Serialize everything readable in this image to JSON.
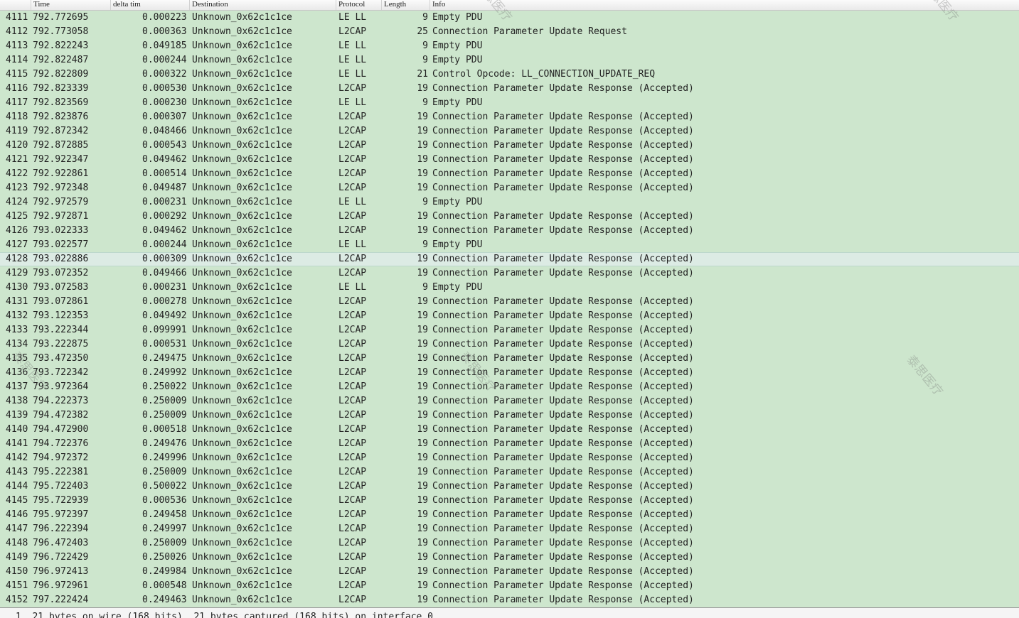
{
  "columns": {
    "time": "Time",
    "delta": "delta tim",
    "destination": "Destination",
    "protocol": "Protocol",
    "length": "Length",
    "info": "Info"
  },
  "rows": [
    {
      "no": "4111",
      "time": "792.772695",
      "delta": "0.000223",
      "destination": "Unknown_0x62c1c1ce",
      "protocol": "LE LL",
      "length": "9",
      "info": "Empty PDU"
    },
    {
      "no": "4112",
      "time": "792.773058",
      "delta": "0.000363",
      "destination": "Unknown_0x62c1c1ce",
      "protocol": "L2CAP",
      "length": "25",
      "info": "Connection Parameter Update Request"
    },
    {
      "no": "4113",
      "time": "792.822243",
      "delta": "0.049185",
      "destination": "Unknown_0x62c1c1ce",
      "protocol": "LE LL",
      "length": "9",
      "info": "Empty PDU"
    },
    {
      "no": "4114",
      "time": "792.822487",
      "delta": "0.000244",
      "destination": "Unknown_0x62c1c1ce",
      "protocol": "LE LL",
      "length": "9",
      "info": "Empty PDU"
    },
    {
      "no": "4115",
      "time": "792.822809",
      "delta": "0.000322",
      "destination": "Unknown_0x62c1c1ce",
      "protocol": "LE LL",
      "length": "21",
      "info": "Control Opcode: LL_CONNECTION_UPDATE_REQ"
    },
    {
      "no": "4116",
      "time": "792.823339",
      "delta": "0.000530",
      "destination": "Unknown_0x62c1c1ce",
      "protocol": "L2CAP",
      "length": "19",
      "info": "Connection Parameter Update Response (Accepted)"
    },
    {
      "no": "4117",
      "time": "792.823569",
      "delta": "0.000230",
      "destination": "Unknown_0x62c1c1ce",
      "protocol": "LE LL",
      "length": "9",
      "info": "Empty PDU"
    },
    {
      "no": "4118",
      "time": "792.823876",
      "delta": "0.000307",
      "destination": "Unknown_0x62c1c1ce",
      "protocol": "L2CAP",
      "length": "19",
      "info": "Connection Parameter Update Response (Accepted)"
    },
    {
      "no": "4119",
      "time": "792.872342",
      "delta": "0.048466",
      "destination": "Unknown_0x62c1c1ce",
      "protocol": "L2CAP",
      "length": "19",
      "info": "Connection Parameter Update Response (Accepted)"
    },
    {
      "no": "4120",
      "time": "792.872885",
      "delta": "0.000543",
      "destination": "Unknown_0x62c1c1ce",
      "protocol": "L2CAP",
      "length": "19",
      "info": "Connection Parameter Update Response (Accepted)"
    },
    {
      "no": "4121",
      "time": "792.922347",
      "delta": "0.049462",
      "destination": "Unknown_0x62c1c1ce",
      "protocol": "L2CAP",
      "length": "19",
      "info": "Connection Parameter Update Response (Accepted)"
    },
    {
      "no": "4122",
      "time": "792.922861",
      "delta": "0.000514",
      "destination": "Unknown_0x62c1c1ce",
      "protocol": "L2CAP",
      "length": "19",
      "info": "Connection Parameter Update Response (Accepted)"
    },
    {
      "no": "4123",
      "time": "792.972348",
      "delta": "0.049487",
      "destination": "Unknown_0x62c1c1ce",
      "protocol": "L2CAP",
      "length": "19",
      "info": "Connection Parameter Update Response (Accepted)"
    },
    {
      "no": "4124",
      "time": "792.972579",
      "delta": "0.000231",
      "destination": "Unknown_0x62c1c1ce",
      "protocol": "LE LL",
      "length": "9",
      "info": "Empty PDU"
    },
    {
      "no": "4125",
      "time": "792.972871",
      "delta": "0.000292",
      "destination": "Unknown_0x62c1c1ce",
      "protocol": "L2CAP",
      "length": "19",
      "info": "Connection Parameter Update Response (Accepted)"
    },
    {
      "no": "4126",
      "time": "793.022333",
      "delta": "0.049462",
      "destination": "Unknown_0x62c1c1ce",
      "protocol": "L2CAP",
      "length": "19",
      "info": "Connection Parameter Update Response (Accepted)"
    },
    {
      "no": "4127",
      "time": "793.022577",
      "delta": "0.000244",
      "destination": "Unknown_0x62c1c1ce",
      "protocol": "LE LL",
      "length": "9",
      "info": "Empty PDU"
    },
    {
      "no": "4128",
      "time": "793.022886",
      "delta": "0.000309",
      "destination": "Unknown_0x62c1c1ce",
      "protocol": "L2CAP",
      "length": "19",
      "info": "Connection Parameter Update Response (Accepted)",
      "selected": true
    },
    {
      "no": "4129",
      "time": "793.072352",
      "delta": "0.049466",
      "destination": "Unknown_0x62c1c1ce",
      "protocol": "L2CAP",
      "length": "19",
      "info": "Connection Parameter Update Response (Accepted)"
    },
    {
      "no": "4130",
      "time": "793.072583",
      "delta": "0.000231",
      "destination": "Unknown_0x62c1c1ce",
      "protocol": "LE LL",
      "length": "9",
      "info": "Empty PDU"
    },
    {
      "no": "4131",
      "time": "793.072861",
      "delta": "0.000278",
      "destination": "Unknown_0x62c1c1ce",
      "protocol": "L2CAP",
      "length": "19",
      "info": "Connection Parameter Update Response (Accepted)"
    },
    {
      "no": "4132",
      "time": "793.122353",
      "delta": "0.049492",
      "destination": "Unknown_0x62c1c1ce",
      "protocol": "L2CAP",
      "length": "19",
      "info": "Connection Parameter Update Response (Accepted)"
    },
    {
      "no": "4133",
      "time": "793.222344",
      "delta": "0.099991",
      "destination": "Unknown_0x62c1c1ce",
      "protocol": "L2CAP",
      "length": "19",
      "info": "Connection Parameter Update Response (Accepted)"
    },
    {
      "no": "4134",
      "time": "793.222875",
      "delta": "0.000531",
      "destination": "Unknown_0x62c1c1ce",
      "protocol": "L2CAP",
      "length": "19",
      "info": "Connection Parameter Update Response (Accepted)"
    },
    {
      "no": "4135",
      "time": "793.472350",
      "delta": "0.249475",
      "destination": "Unknown_0x62c1c1ce",
      "protocol": "L2CAP",
      "length": "19",
      "info": "Connection Parameter Update Response (Accepted)"
    },
    {
      "no": "4136",
      "time": "793.722342",
      "delta": "0.249992",
      "destination": "Unknown_0x62c1c1ce",
      "protocol": "L2CAP",
      "length": "19",
      "info": "Connection Parameter Update Response (Accepted)"
    },
    {
      "no": "4137",
      "time": "793.972364",
      "delta": "0.250022",
      "destination": "Unknown_0x62c1c1ce",
      "protocol": "L2CAP",
      "length": "19",
      "info": "Connection Parameter Update Response (Accepted)"
    },
    {
      "no": "4138",
      "time": "794.222373",
      "delta": "0.250009",
      "destination": "Unknown_0x62c1c1ce",
      "protocol": "L2CAP",
      "length": "19",
      "info": "Connection Parameter Update Response (Accepted)"
    },
    {
      "no": "4139",
      "time": "794.472382",
      "delta": "0.250009",
      "destination": "Unknown_0x62c1c1ce",
      "protocol": "L2CAP",
      "length": "19",
      "info": "Connection Parameter Update Response (Accepted)"
    },
    {
      "no": "4140",
      "time": "794.472900",
      "delta": "0.000518",
      "destination": "Unknown_0x62c1c1ce",
      "protocol": "L2CAP",
      "length": "19",
      "info": "Connection Parameter Update Response (Accepted)"
    },
    {
      "no": "4141",
      "time": "794.722376",
      "delta": "0.249476",
      "destination": "Unknown_0x62c1c1ce",
      "protocol": "L2CAP",
      "length": "19",
      "info": "Connection Parameter Update Response (Accepted)"
    },
    {
      "no": "4142",
      "time": "794.972372",
      "delta": "0.249996",
      "destination": "Unknown_0x62c1c1ce",
      "protocol": "L2CAP",
      "length": "19",
      "info": "Connection Parameter Update Response (Accepted)"
    },
    {
      "no": "4143",
      "time": "795.222381",
      "delta": "0.250009",
      "destination": "Unknown_0x62c1c1ce",
      "protocol": "L2CAP",
      "length": "19",
      "info": "Connection Parameter Update Response (Accepted)"
    },
    {
      "no": "4144",
      "time": "795.722403",
      "delta": "0.500022",
      "destination": "Unknown_0x62c1c1ce",
      "protocol": "L2CAP",
      "length": "19",
      "info": "Connection Parameter Update Response (Accepted)"
    },
    {
      "no": "4145",
      "time": "795.722939",
      "delta": "0.000536",
      "destination": "Unknown_0x62c1c1ce",
      "protocol": "L2CAP",
      "length": "19",
      "info": "Connection Parameter Update Response (Accepted)"
    },
    {
      "no": "4146",
      "time": "795.972397",
      "delta": "0.249458",
      "destination": "Unknown_0x62c1c1ce",
      "protocol": "L2CAP",
      "length": "19",
      "info": "Connection Parameter Update Response (Accepted)"
    },
    {
      "no": "4147",
      "time": "796.222394",
      "delta": "0.249997",
      "destination": "Unknown_0x62c1c1ce",
      "protocol": "L2CAP",
      "length": "19",
      "info": "Connection Parameter Update Response (Accepted)"
    },
    {
      "no": "4148",
      "time": "796.472403",
      "delta": "0.250009",
      "destination": "Unknown_0x62c1c1ce",
      "protocol": "L2CAP",
      "length": "19",
      "info": "Connection Parameter Update Response (Accepted)"
    },
    {
      "no": "4149",
      "time": "796.722429",
      "delta": "0.250026",
      "destination": "Unknown_0x62c1c1ce",
      "protocol": "L2CAP",
      "length": "19",
      "info": "Connection Parameter Update Response (Accepted)"
    },
    {
      "no": "4150",
      "time": "796.972413",
      "delta": "0.249984",
      "destination": "Unknown_0x62c1c1ce",
      "protocol": "L2CAP",
      "length": "19",
      "info": "Connection Parameter Update Response (Accepted)"
    },
    {
      "no": "4151",
      "time": "796.972961",
      "delta": "0.000548",
      "destination": "Unknown_0x62c1c1ce",
      "protocol": "L2CAP",
      "length": "19",
      "info": "Connection Parameter Update Response (Accepted)"
    },
    {
      "no": "4152",
      "time": "797.222424",
      "delta": "0.249463",
      "destination": "Unknown_0x62c1c1ce",
      "protocol": "L2CAP",
      "length": "19",
      "info": "Connection Parameter Update Response (Accepted)"
    }
  ],
  "status_bar": {
    "text": "1  21 bytes on wire (168 bits), 21 bytes captured (168 bits) on interface 0"
  },
  "watermark": {
    "text": "泰思医疗"
  },
  "colors": {
    "row_background": "#cde6cd",
    "selected_row": "#dcebe4"
  }
}
